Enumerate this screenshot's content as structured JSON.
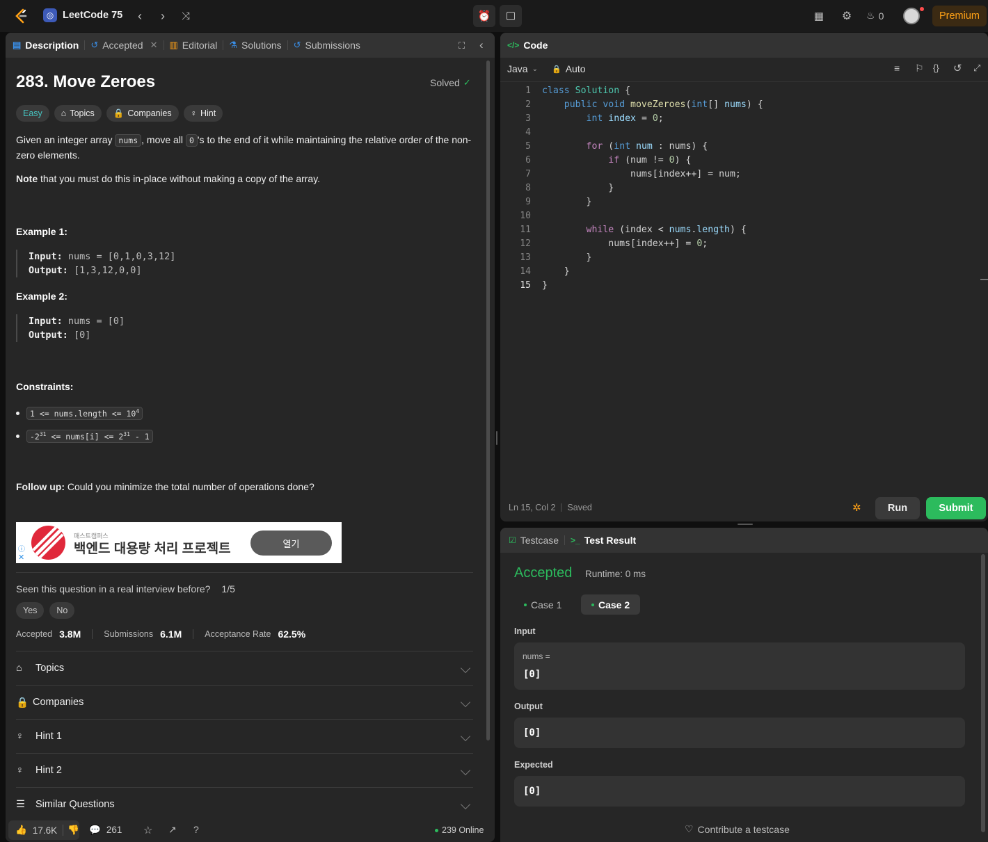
{
  "topbar": {
    "list_title": "LeetCode 75",
    "streak": "0",
    "premium": "Premium"
  },
  "tabs": {
    "description": "Description",
    "accepted": "Accepted",
    "editorial": "Editorial",
    "solutions": "Solutions",
    "submissions": "Submissions"
  },
  "problem": {
    "title": "283. Move Zeroes",
    "solved": "Solved",
    "difficulty": "Easy",
    "topics_pill": "Topics",
    "companies_pill": "Companies",
    "hint_pill": "Hint",
    "desc_1": "Given an integer array",
    "desc_code_nums": "nums",
    "desc_2": ", move all",
    "desc_code_zero": "0",
    "desc_3": "'s to the end of it while maintaining the relative order of the non-zero elements.",
    "note_bold": "Note",
    "note_rest": " that you must do this in-place without making a copy of the array.",
    "ex1_title": "Example 1:",
    "ex1_in_lbl": "Input:",
    "ex1_in": " nums = [0,1,0,3,12]",
    "ex1_out_lbl": "Output:",
    "ex1_out": " [1,3,12,0,0]",
    "ex2_title": "Example 2:",
    "ex2_in_lbl": "Input:",
    "ex2_in": " nums = [0]",
    "ex2_out_lbl": "Output:",
    "ex2_out": " [0]",
    "constraints_title": "Constraints:",
    "c1_a": "1 <= nums.length <= 10",
    "c1_sup": "4",
    "c2_a": "-2",
    "c2_sup1": "31",
    "c2_b": " <= nums[i] <= 2",
    "c2_sup2": "31",
    "c2_c": " - 1",
    "follow_bold": "Follow up:",
    "follow_rest": " Could you minimize the total number of operations done?"
  },
  "ad": {
    "small": "패스트캠퍼스",
    "headline": "백엔드 대용량 처리 프로젝트",
    "button": "열기"
  },
  "interview": {
    "question": "Seen this question in a real interview before?",
    "count": "1/5",
    "yes": "Yes",
    "no": "No"
  },
  "stats": {
    "accepted_lbl": "Accepted",
    "accepted_val": "3.8M",
    "subs_lbl": "Submissions",
    "subs_val": "6.1M",
    "rate_lbl": "Acceptance Rate",
    "rate_val": "62.5%"
  },
  "accordion": [
    "Topics",
    "Companies",
    "Hint 1",
    "Hint 2",
    "Similar Questions"
  ],
  "footer": {
    "likes": "17.6K",
    "comments": "261",
    "online": "239 Online"
  },
  "editor": {
    "tab": "Code",
    "language": "Java",
    "mode": "Auto",
    "status_pos": "Ln 15, Col 2",
    "status_saved": "Saved",
    "run": "Run",
    "submit": "Submit"
  },
  "code_lines": [
    [
      [
        "kb",
        "class "
      ],
      [
        "ty",
        "Solution"
      ],
      [
        "tx",
        " {"
      ]
    ],
    [
      [
        "tx",
        "    "
      ],
      [
        "kb",
        "public void "
      ],
      [
        "fn",
        "moveZeroes"
      ],
      [
        "tx",
        "("
      ],
      [
        "kb",
        "int"
      ],
      [
        "tx",
        "[] "
      ],
      [
        "pa",
        "nums"
      ],
      [
        "tx",
        ") {"
      ]
    ],
    [
      [
        "tx",
        "        "
      ],
      [
        "kb",
        "int "
      ],
      [
        "pa",
        "index"
      ],
      [
        "tx",
        " = "
      ],
      [
        "nm",
        "0"
      ],
      [
        "tx",
        ";"
      ]
    ],
    [],
    [
      [
        "tx",
        "        "
      ],
      [
        "kw",
        "for "
      ],
      [
        "tx",
        "("
      ],
      [
        "kb",
        "int "
      ],
      [
        "pa",
        "num"
      ],
      [
        "tx",
        " : nums) {"
      ]
    ],
    [
      [
        "tx",
        "            "
      ],
      [
        "kw",
        "if "
      ],
      [
        "tx",
        "(num != "
      ],
      [
        "nm",
        "0"
      ],
      [
        "tx",
        ") {"
      ]
    ],
    [
      [
        "tx",
        "                nums[index++] = num;"
      ]
    ],
    [
      [
        "tx",
        "            }"
      ]
    ],
    [
      [
        "tx",
        "        }"
      ]
    ],
    [],
    [
      [
        "tx",
        "        "
      ],
      [
        "kw",
        "while "
      ],
      [
        "tx",
        "(index < "
      ],
      [
        "pa",
        "nums"
      ],
      [
        "tx",
        "."
      ],
      [
        "pa",
        "length"
      ],
      [
        "tx",
        ") {"
      ]
    ],
    [
      [
        "tx",
        "            nums[index++] = "
      ],
      [
        "nm",
        "0"
      ],
      [
        "tx",
        ";"
      ]
    ],
    [
      [
        "tx",
        "        }"
      ]
    ],
    [
      [
        "tx",
        "    }"
      ]
    ],
    [
      [
        "tx",
        "}"
      ]
    ]
  ],
  "line_numbers": [
    "1",
    "2",
    "3",
    "4",
    "5",
    "6",
    "7",
    "8",
    "9",
    "10",
    "11",
    "12",
    "13",
    "14",
    "15"
  ],
  "result": {
    "testcase_tab": "Testcase",
    "result_tab": "Test Result",
    "status": "Accepted",
    "runtime": "Runtime: 0 ms",
    "case1": "Case 1",
    "case2": "Case 2",
    "input_lbl": "Input",
    "input_var": "nums =",
    "input_val": "[0]",
    "output_lbl": "Output",
    "output_val": "[0]",
    "expected_lbl": "Expected",
    "expected_val": "[0]",
    "contribute": "Contribute a testcase"
  },
  "colors": {
    "accent_green": "#2cbb5d",
    "easy": "#46c6c2",
    "premium": "#ffa116"
  }
}
